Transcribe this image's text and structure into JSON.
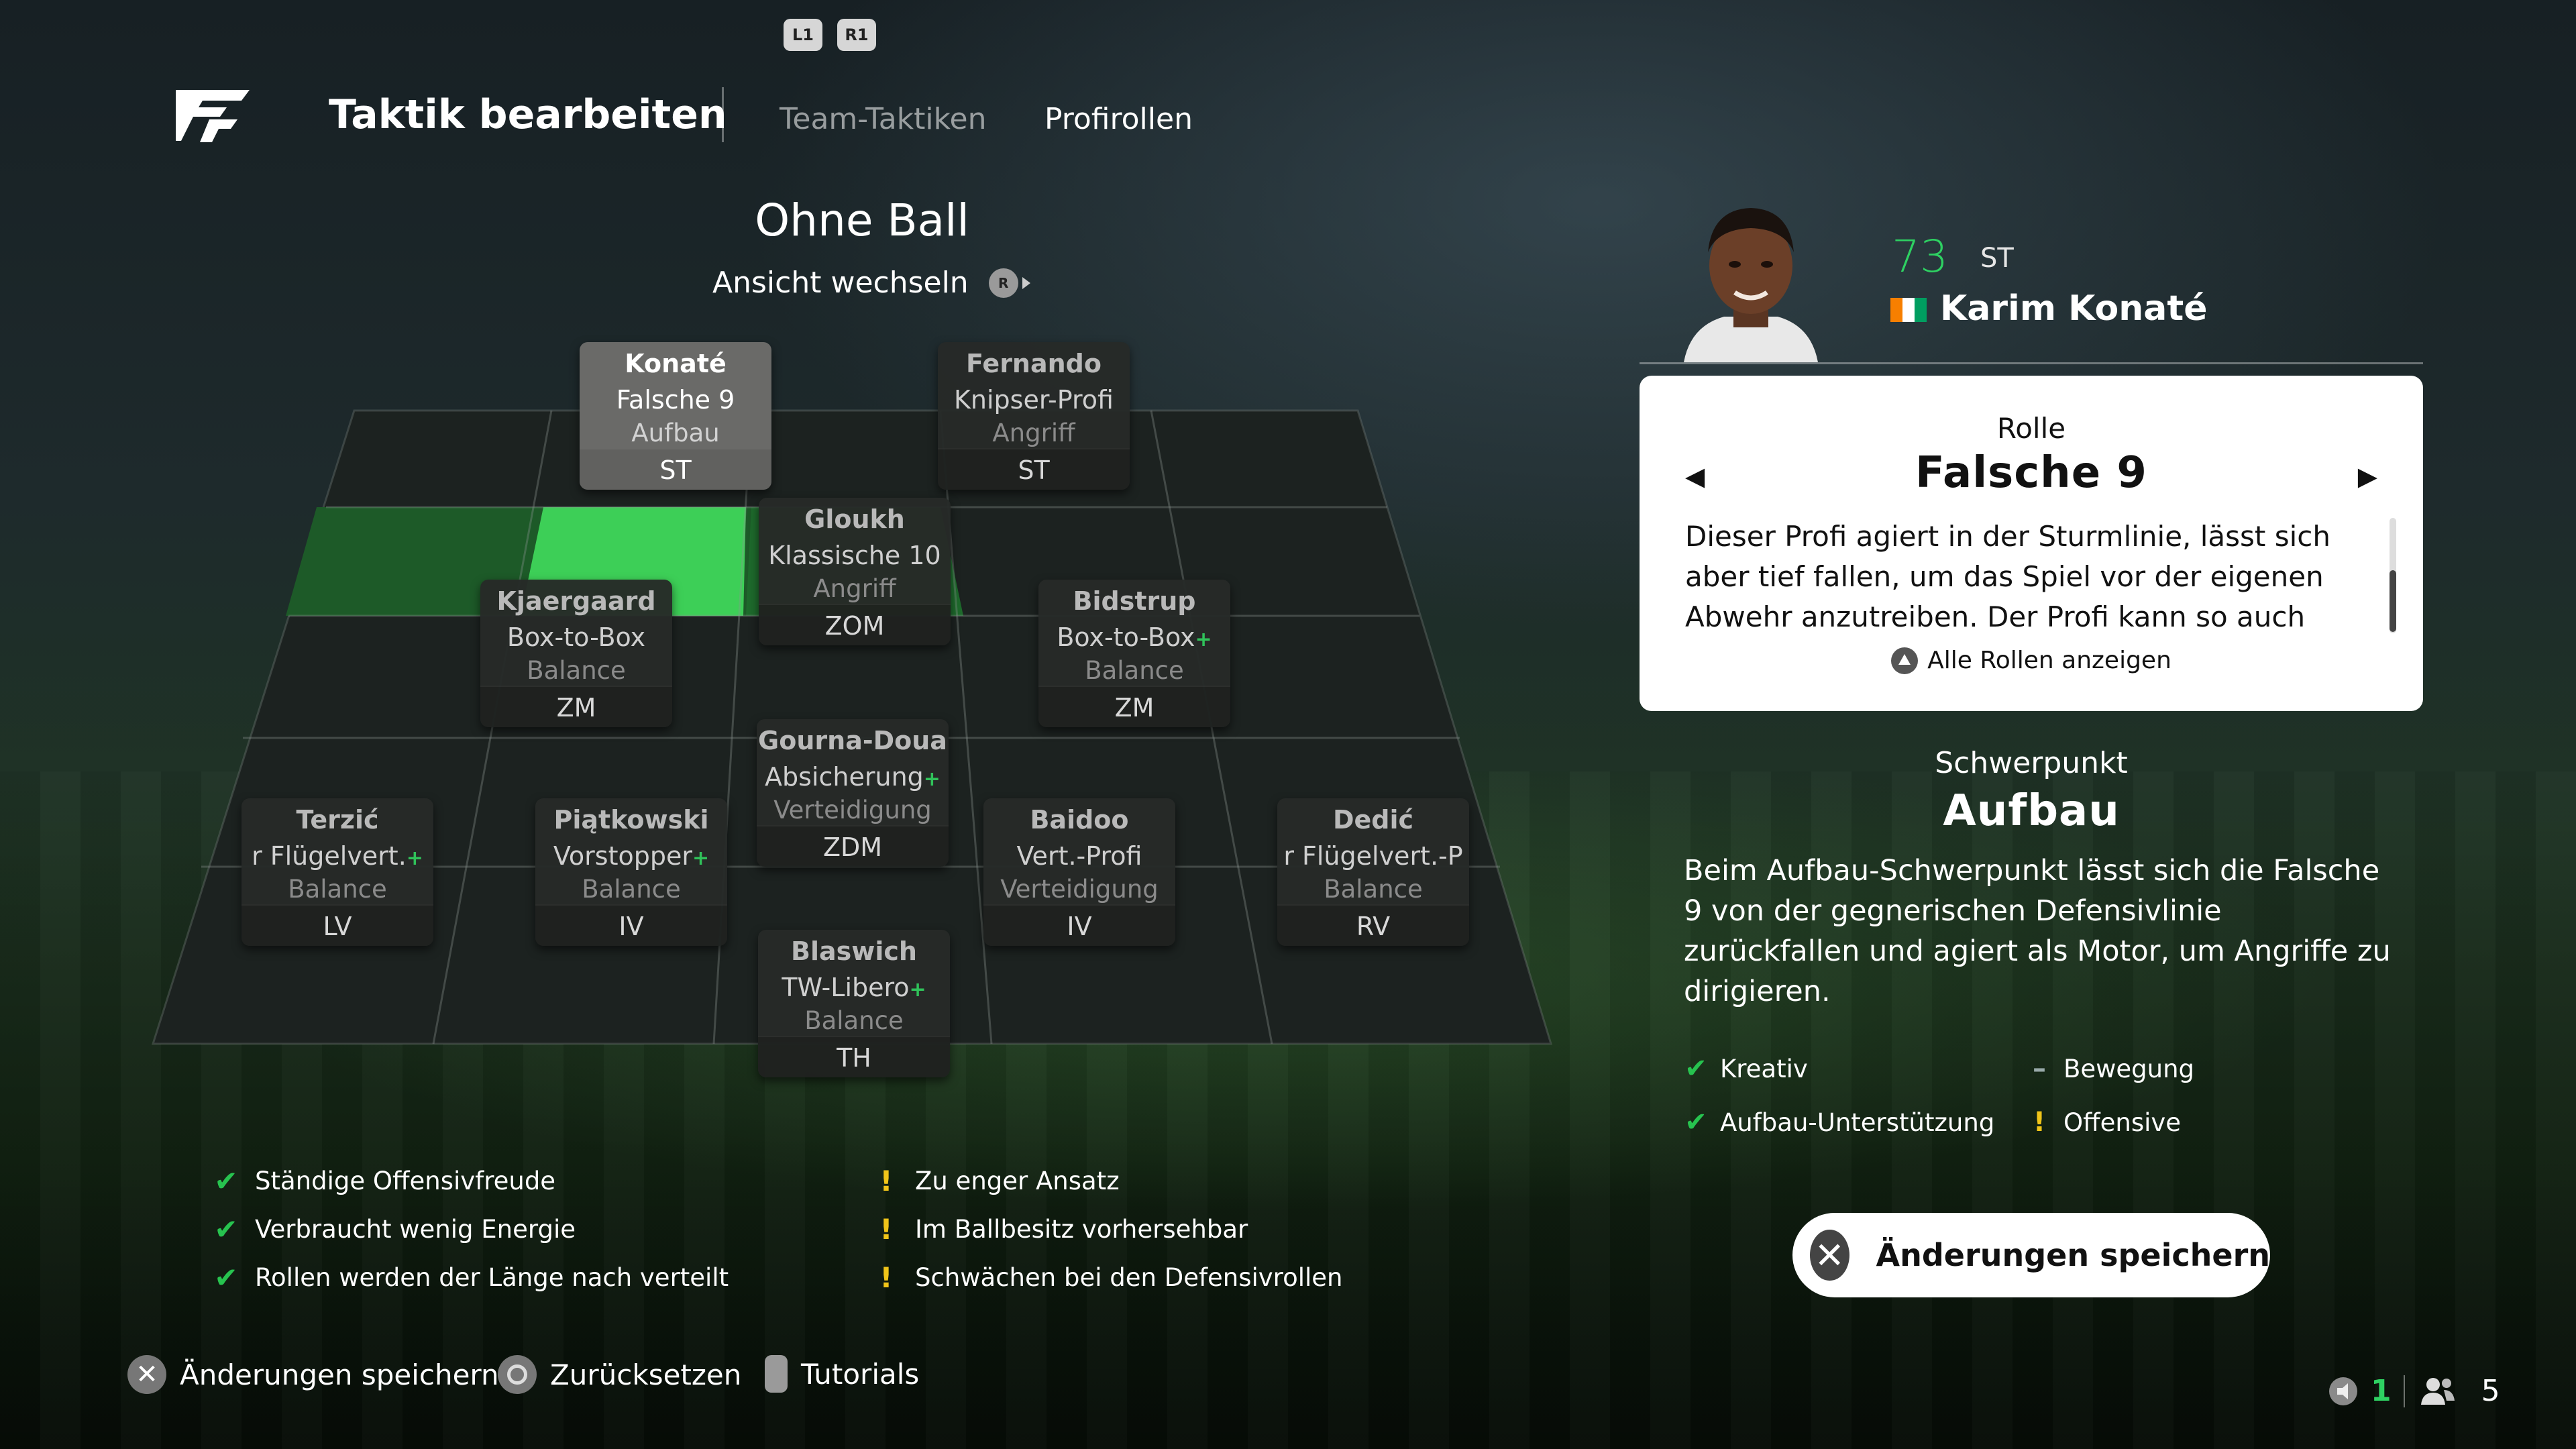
{
  "header": {
    "title": "Taktik bearbeiten",
    "bumpers": [
      "L1",
      "R1"
    ],
    "tabs": [
      {
        "label": "Team-Taktiken",
        "active": false
      },
      {
        "label": "Profirollen",
        "active": true
      }
    ]
  },
  "mode": {
    "title": "Ohne Ball",
    "switch_label": "Ansicht wechseln",
    "switch_button": "R"
  },
  "players": [
    {
      "name": "Konaté",
      "role": "Falsche 9",
      "focus": "Aufbau",
      "pos": "ST",
      "selected": true,
      "plus": false
    },
    {
      "name": "Fernando",
      "role": "Knipser-Profi",
      "focus": "Angriff",
      "pos": "ST",
      "selected": false,
      "plus": false
    },
    {
      "name": "Gloukh",
      "role": "Klassische 10",
      "focus": "Angriff",
      "pos": "ZOM",
      "selected": false,
      "plus": false
    },
    {
      "name": "Kjaergaard",
      "role": "Box-to-Box",
      "focus": "Balance",
      "pos": "ZM",
      "selected": false,
      "plus": false
    },
    {
      "name": "Bidstrup",
      "role": "Box-to-Box",
      "focus": "Balance",
      "pos": "ZM",
      "selected": false,
      "plus": true
    },
    {
      "name": "Gourna-Doua",
      "role": "Absicherung",
      "focus": "Verteidigung",
      "pos": "ZDM",
      "selected": false,
      "plus": true
    },
    {
      "name": "Terzić",
      "role": "r Flügelvert.",
      "focus": "Balance",
      "pos": "LV",
      "selected": false,
      "plus": true
    },
    {
      "name": "Piątkowski",
      "role": "Vorstopper",
      "focus": "Balance",
      "pos": "IV",
      "selected": false,
      "plus": true
    },
    {
      "name": "Baidoo",
      "role": "Vert.-Profi",
      "focus": "Verteidigung",
      "pos": "IV",
      "selected": false,
      "plus": false
    },
    {
      "name": "Dedić",
      "role": "r Flügelvert.-P",
      "focus": "Balance",
      "pos": "RV",
      "selected": false,
      "plus": false
    },
    {
      "name": "Blaswich",
      "role": "TW-Libero",
      "focus": "Balance",
      "pos": "TH",
      "selected": false,
      "plus": true
    }
  ],
  "strengths": [
    "Ständige Offensivfreude",
    "Verbraucht wenig Energie",
    "Rollen werden der Länge nach verteilt"
  ],
  "weaknesses": [
    "Zu enger Ansatz",
    "Im Ballbesitz vorhersehbar",
    "Schwächen bei den Defensivrollen"
  ],
  "selected_player": {
    "rating": "73",
    "position": "ST",
    "name": "Karim Konaté",
    "flag_colors": [
      "#f77f00",
      "#ffffff",
      "#009e60"
    ]
  },
  "role_panel": {
    "label": "Rolle",
    "role_name": "Falsche 9",
    "description": "Dieser Profi agiert in der Sturmlinie, lässt sich aber tief fallen, um das Spiel vor der eigenen Abwehr anzutreiben. Der Profi kann so auch defensive",
    "all_roles": "Alle Rollen anzeigen"
  },
  "focus_panel": {
    "label": "Schwerpunkt",
    "name": "Aufbau",
    "description": "Beim Aufbau-Schwerpunkt lässt sich die Falsche 9 von der gegnerischen Defensivlinie zurückfallen und agiert als Motor, um Angriffe zu dirigieren."
  },
  "attributes": [
    {
      "label": "Kreativ",
      "status": "positive"
    },
    {
      "label": "Bewegung",
      "status": "neutral"
    },
    {
      "label": "Aufbau-Unterstützung",
      "status": "positive"
    },
    {
      "label": "Offensive",
      "status": "warning"
    }
  ],
  "save_button": "Änderungen speichern",
  "footer": {
    "save": "Änderungen speichern",
    "reset": "Zurücksetzen",
    "tutorials": "Tutorials"
  },
  "status_bar": {
    "notifications": "1",
    "players_online": "5"
  },
  "colors": {
    "accent_green": "#2ed162",
    "highlight_green": "#3dcf57",
    "warning": "#f0c419"
  }
}
